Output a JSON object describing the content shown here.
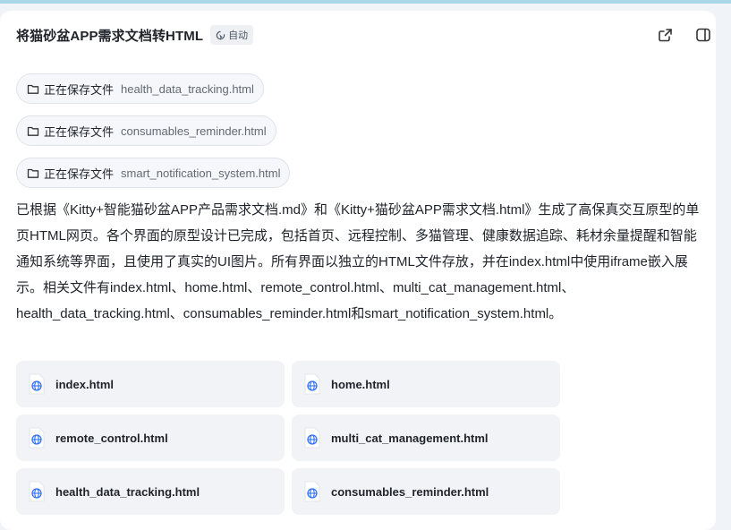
{
  "header": {
    "title": "将猫砂盆APP需求文档转HTML",
    "badge": "自动"
  },
  "saves": [
    {
      "action": "正在保存文件",
      "file": "health_data_tracking.html"
    },
    {
      "action": "正在保存文件",
      "file": "consumables_reminder.html"
    },
    {
      "action": "正在保存文件",
      "file": "smart_notification_system.html"
    }
  ],
  "summary": "已根据《Kitty+智能猫砂盆APP产品需求文档.md》和《Kitty+猫砂盆APP需求文档.html》生成了高保真交互原型的单页HTML网页。各个界面的原型设计已完成，包括首页、远程控制、多猫管理、健康数据追踪、耗材余量提醒和智能通知系统等界面，且使用了真实的UI图片。所有界面以独立的HTML文件存放，并在index.html中使用iframe嵌入展示。相关文件有index.html、home.html、remote_control.html、multi_cat_management.html、health_data_tracking.html、consumables_reminder.html和smart_notification_system.html。",
  "files": [
    "index.html",
    "home.html",
    "remote_control.html",
    "multi_cat_management.html",
    "health_data_tracking.html",
    "consumables_reminder.html"
  ]
}
